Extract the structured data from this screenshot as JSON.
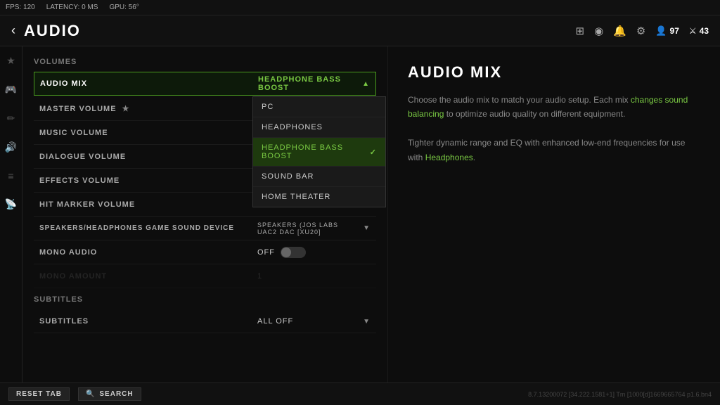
{
  "topbar": {
    "fps_label": "FPS:",
    "fps_value": "120",
    "latency_label": "LATENCY:",
    "latency_value": "0 MS",
    "gpu_label": "GPU:",
    "gpu_value": "56°"
  },
  "header": {
    "back_label": "‹",
    "title": "AUDIO",
    "icons": [
      "⊞",
      "🎧",
      "🔔",
      "⚙"
    ],
    "player_level": "97",
    "multiplayer_count": "43"
  },
  "sidebar": {
    "icons": [
      "★",
      "🎮",
      "✏",
      "🔊",
      "≡",
      "📡"
    ]
  },
  "volumes_section": {
    "title": "VOLUMES",
    "rows": [
      {
        "label": "AUDIO MIX",
        "value": "HEADPHONE BASS BOOST",
        "highlighted": true
      },
      {
        "label": "MASTER VOLUME",
        "value": "",
        "has_star": true
      },
      {
        "label": "MUSIC VOLUME",
        "value": ""
      },
      {
        "label": "DIALOGUE VOLUME",
        "value": ""
      },
      {
        "label": "EFFECTS VOLUME",
        "value": ""
      },
      {
        "label": "HIT MARKER VOLUME",
        "value": ""
      },
      {
        "label": "SPEAKERS/HEADPHONES GAME SOUND DEVICE",
        "value": "SPEAKERS (JOS LABS UAC2 DAC [XU20]",
        "has_dropdown": true
      },
      {
        "label": "MONO AUDIO",
        "value": "OFF",
        "has_toggle": true
      },
      {
        "label": "MONO AMOUNT",
        "value": "1",
        "has_slider": true,
        "disabled": true
      }
    ]
  },
  "dropdown": {
    "items": [
      {
        "label": "PC",
        "selected": false
      },
      {
        "label": "HEADPHONES",
        "selected": false
      },
      {
        "label": "HEADPHONE BASS BOOST",
        "selected": true
      },
      {
        "label": "SOUND BAR",
        "selected": false
      },
      {
        "label": "HOME THEATER",
        "selected": false
      }
    ]
  },
  "subtitles_section": {
    "title": "SUBTITLES",
    "rows": [
      {
        "label": "SUBTITLES",
        "value": "ALL OFF"
      }
    ]
  },
  "info_panel": {
    "title": "AUDIO MIX",
    "body_line1": "Choose the audio mix to match your audio setup. Each mix",
    "body_link1": "changes sound balancing",
    "body_line2": "to optimize audio quality on different equipment.",
    "body_line3": "",
    "body_line4": "Tighter dynamic range and EQ with enhanced low-end frequencies for use with",
    "body_link2": "Headphones",
    "body_period": "."
  },
  "bottombar": {
    "reset_label": "RESET TAB",
    "search_label": "SEARCH",
    "version_info": "8.7.13200072 [34.222.1581+1] Tm [1000[d]1669665764 p1.6.bn4"
  }
}
